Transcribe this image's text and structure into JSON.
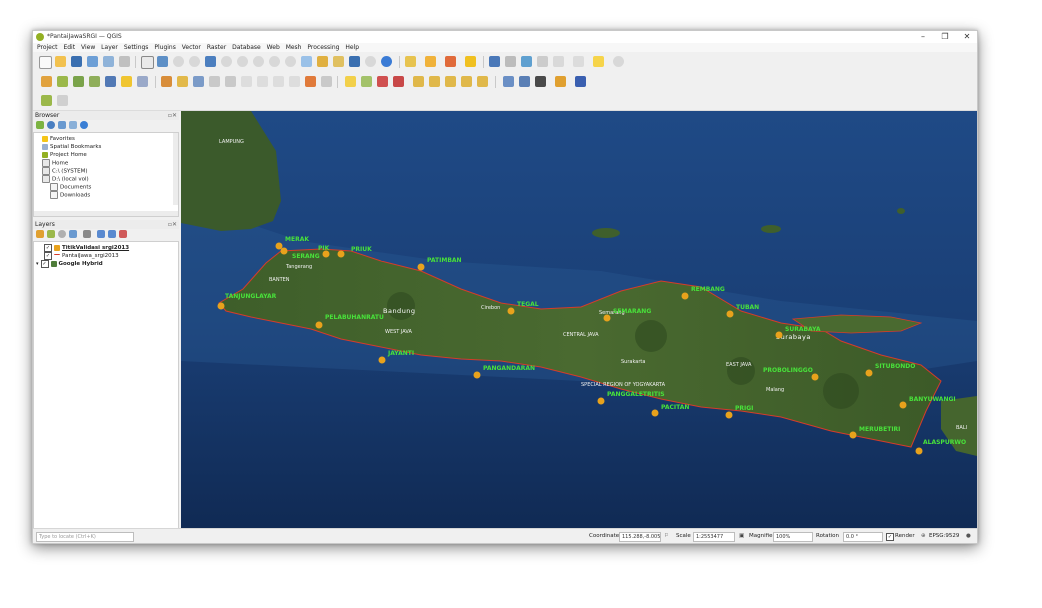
{
  "window": {
    "title": "*PantaiJawaSRGI — QGIS",
    "controls": {
      "minimize": "–",
      "maximize": "❐",
      "close": "✕"
    }
  },
  "menu": [
    "Project",
    "Edit",
    "View",
    "Layer",
    "Settings",
    "Plugins",
    "Vector",
    "Raster",
    "Database",
    "Web",
    "Mesh",
    "Processing",
    "Help"
  ],
  "browser_panel": {
    "title": "Browser",
    "items": [
      {
        "label": "Favorites",
        "icon": "star-icon"
      },
      {
        "label": "Spatial Bookmarks",
        "icon": "bookmark-icon"
      },
      {
        "label": "Project Home",
        "icon": "folder-icon"
      },
      {
        "label": "Home",
        "icon": "folder-icon"
      },
      {
        "label": "C:\\ (SYSTEM)",
        "icon": "drive-icon"
      },
      {
        "label": "D:\\ (local vol)",
        "icon": "drive-icon"
      },
      {
        "label": "Documents",
        "icon": "folder-icon"
      },
      {
        "label": "Downloads",
        "icon": "folder-icon"
      }
    ]
  },
  "layers_panel": {
    "title": "Layers",
    "layers": [
      {
        "label": "TitikValidasi srgi2013",
        "checked": true,
        "icon": "point-layer-icon"
      },
      {
        "label": "PantaiJawa_srgi2013",
        "checked": true,
        "icon": "line-layer-icon"
      },
      {
        "label": "Google Hybrid",
        "checked": true,
        "icon": "raster-layer-icon"
      }
    ]
  },
  "map": {
    "points": [
      {
        "label": "MERAK"
      },
      {
        "label": "PIK"
      },
      {
        "label": "PRIUK"
      },
      {
        "label": "SERANG"
      },
      {
        "label": "PATIMBAN"
      },
      {
        "label": "TANJUNGLAYAR"
      },
      {
        "label": "PELABUHANRATU"
      },
      {
        "label": "JAYANTI"
      },
      {
        "label": "TEGAL"
      },
      {
        "label": "SEMARANG"
      },
      {
        "label": "REMBANG"
      },
      {
        "label": "TUBAN"
      },
      {
        "label": "SURABAYA"
      },
      {
        "label": "PANGANDARAN"
      },
      {
        "label": "PRIGI"
      },
      {
        "label": "PROBOLINGGO"
      },
      {
        "label": "SITUBONDO"
      },
      {
        "label": "BANYUWANGI"
      },
      {
        "label": "MERUBETIRI"
      },
      {
        "label": "ALASPURWO"
      },
      {
        "label": "PACITAN"
      },
      {
        "label": "PANGGALETRITIS"
      }
    ],
    "places": [
      "LAMPUNG",
      "Bandung",
      "WEST JAVA",
      "CENTRAL JAVA",
      "EAST JAVA",
      "SPECIAL REGION OF YOGYAKARTA",
      "Surakarta",
      "Malang",
      "Surabaya",
      "BALI",
      "Cirebon",
      "Tangerang",
      "BANTEN",
      "Semarang"
    ]
  },
  "status": {
    "locate_placeholder": "Type to locate (Ctrl+K)",
    "coordinate_label": "Coordinate",
    "coordinate_value": "115.288,-8.005",
    "scale_label": "Scale",
    "scale_value": "1:2553477",
    "magnifier_label": "Magnifier",
    "magnifier_value": "100%",
    "rotation_label": "Rotation",
    "rotation_value": "0.0 °",
    "render_label": "Render",
    "crs": "EPSG:9529"
  },
  "colors": {
    "qgis_green": "#93b023",
    "label_green": "#48e23a",
    "marker_orange": "#e8a21c",
    "coast_red": "#d63c2a"
  }
}
